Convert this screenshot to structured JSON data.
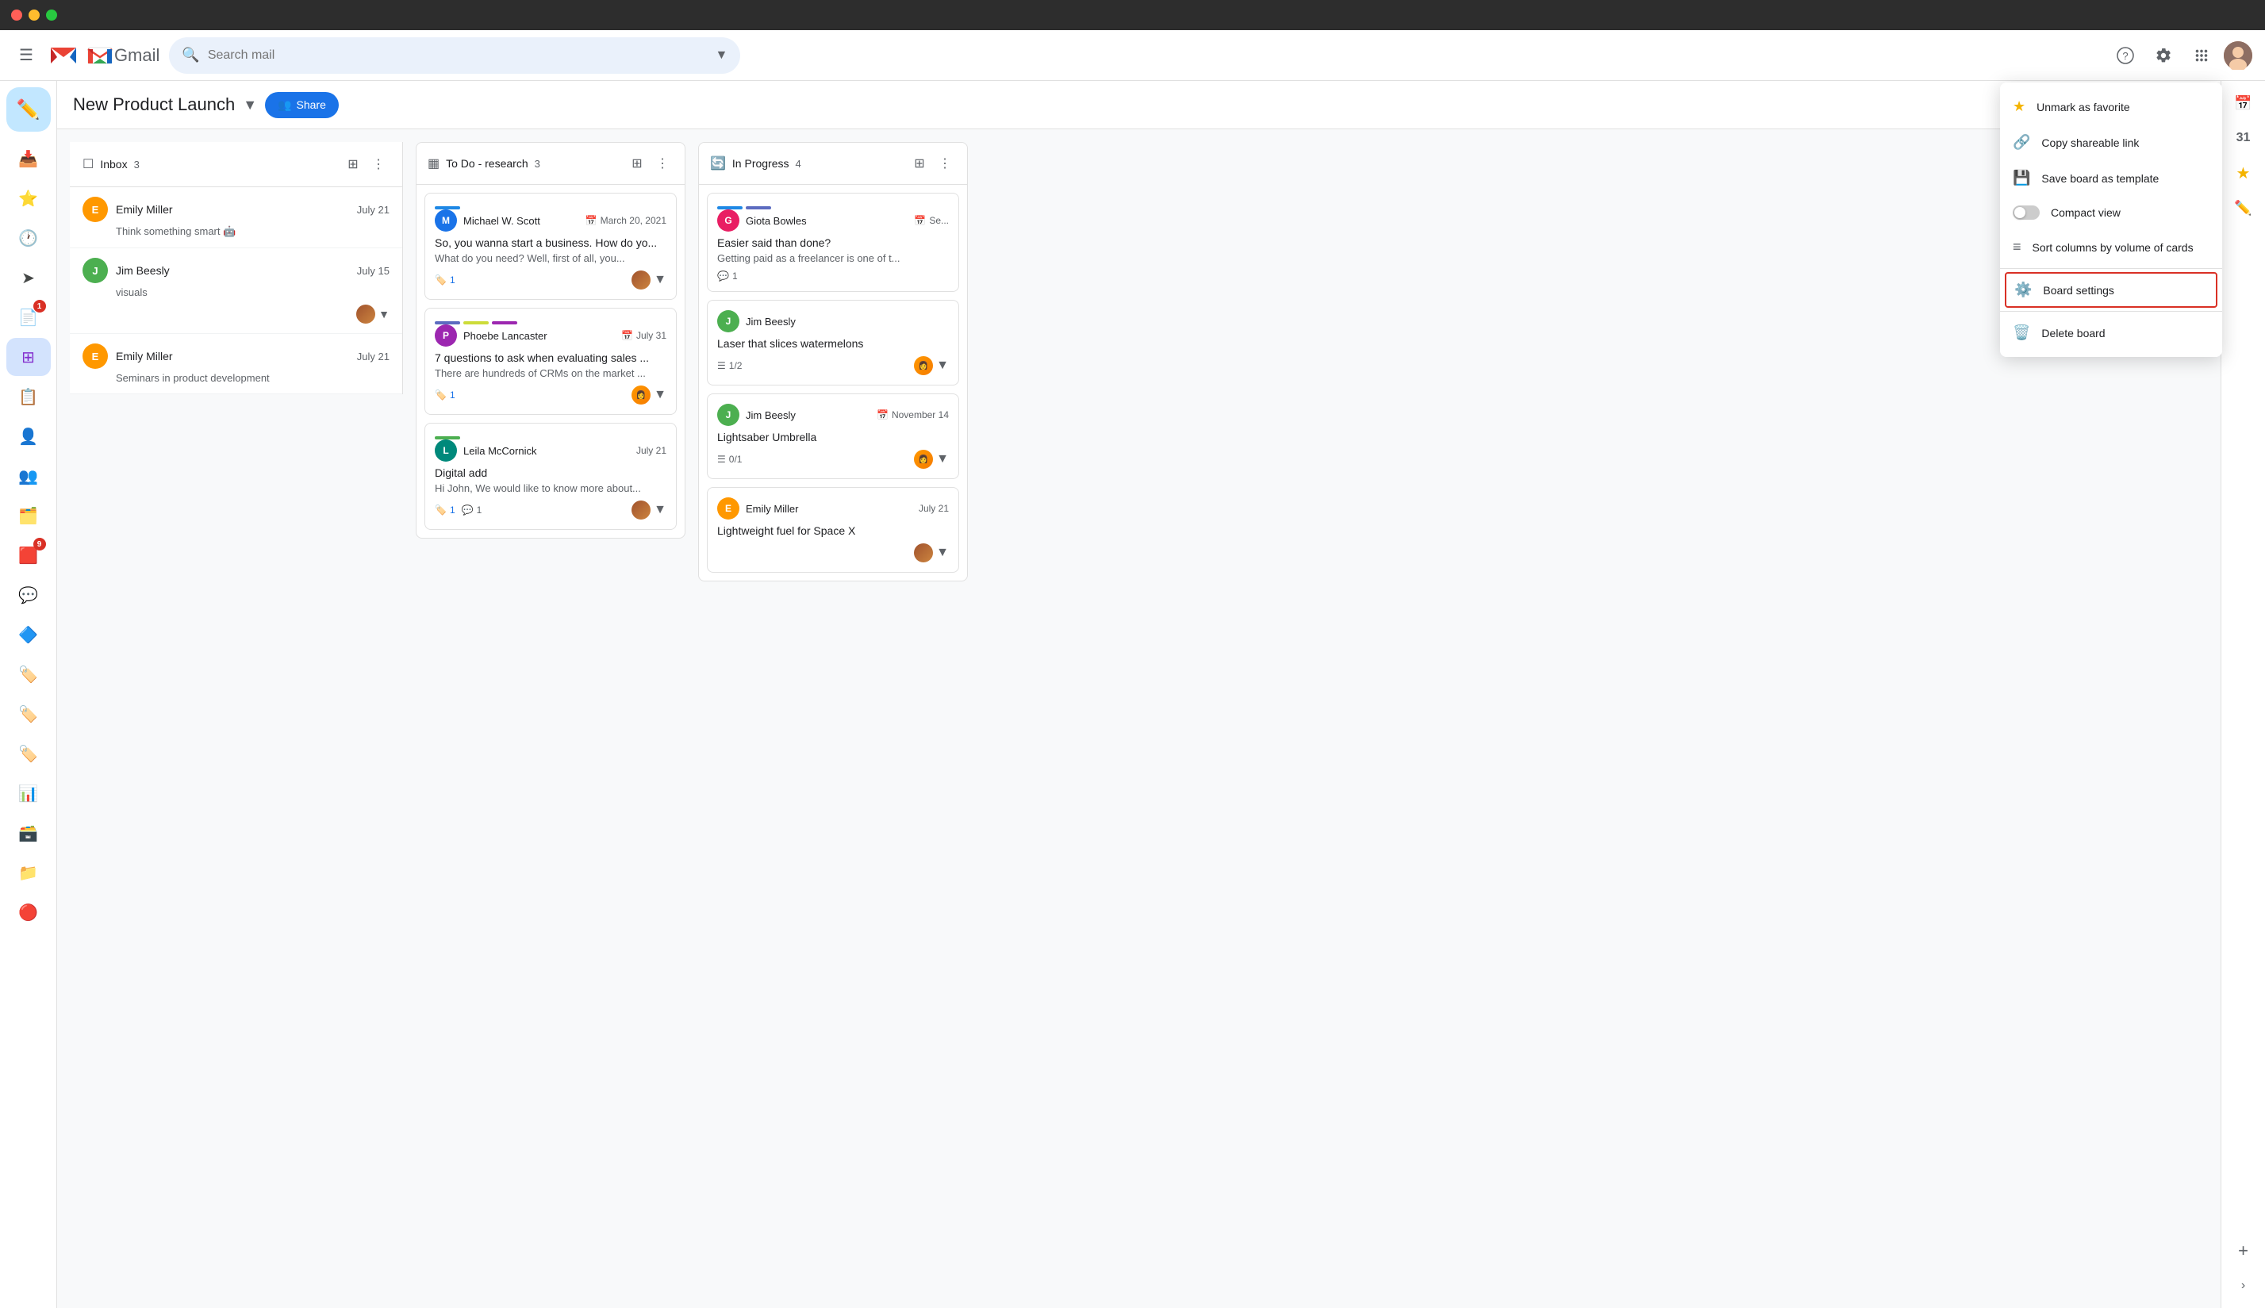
{
  "titlebar": {
    "close": "close",
    "minimize": "minimize",
    "maximize": "maximize"
  },
  "topbar": {
    "menu_label": "menu",
    "gmail_label": "Gmail",
    "search_placeholder": "Search mail",
    "help_label": "help",
    "settings_label": "settings",
    "apps_label": "apps",
    "avatar_label": "User avatar"
  },
  "board": {
    "title": "New Product Launch",
    "share_label": "Share",
    "three_dots_label": "More options"
  },
  "inbox_column": {
    "icon": "📥",
    "title": "Inbox",
    "count": "3",
    "items": [
      {
        "author": "Emily Miller",
        "date": "July 21",
        "preview": "Think something smart 🤖",
        "avatar_letter": "E",
        "avatar_color": "av-e"
      },
      {
        "author": "Jim Beesly",
        "date": "July 15",
        "preview": "visuals",
        "avatar_letter": "J",
        "avatar_color": "av-j"
      },
      {
        "author": "Emily Miller",
        "date": "July 21",
        "preview": "Seminars in product development",
        "avatar_letter": "E",
        "avatar_color": "av-e"
      }
    ]
  },
  "todo_column": {
    "title": "To Do - research",
    "count": "3",
    "cards": [
      {
        "author": "Michael W. Scott",
        "date": "March 20, 2021",
        "title": "So, you wanna start a business. How do yo...",
        "desc": "What do you need? Well, first of all, you...",
        "tags_count": "1",
        "avatar_letter": "M",
        "avatar_color": "av-m",
        "tag_colors": [
          "#1e88e5"
        ]
      },
      {
        "author": "Phoebe Lancaster",
        "date": "July 31",
        "title": "7 questions to ask when evaluating sales ...",
        "desc": "There are hundreds of CRMs on the market ...",
        "tags_count": "1",
        "avatar_letter": "P",
        "avatar_color": "av-p",
        "tag_colors": [
          "#5c6bc0",
          "#cddc39",
          "#9c27b0"
        ]
      },
      {
        "author": "Leila McCornick",
        "date": "July 21",
        "title": "Digital add",
        "desc": "Hi John, We would like to know more about...",
        "tags_count": "1",
        "comments_count": "1",
        "avatar_letter": "L",
        "avatar_color": "av-l",
        "tag_colors": [
          "#4caf50"
        ]
      }
    ]
  },
  "inprogress_column": {
    "title": "In Progress",
    "count": "4",
    "cards": [
      {
        "author": "Giota Bowles",
        "date": "Se...",
        "title": "Easier said than done?",
        "desc": "Getting paid as a freelancer is one of t...",
        "comments_count": "1",
        "avatar_letter": "G",
        "avatar_color": "av-g",
        "tag_colors": [
          "#1e88e5",
          "#5c6bc0"
        ]
      },
      {
        "author": "Jim Beesly",
        "date": "",
        "title": "Laser that slices watermelons",
        "desc": "",
        "checklist": "1/2",
        "avatar_letter": "J",
        "avatar_color": "av-j"
      },
      {
        "author": "Jim Beesly",
        "date": "November 14",
        "title": "Lightsaber Umbrella",
        "desc": "",
        "checklist": "0/1",
        "avatar_letter": "J",
        "avatar_color": "av-j"
      },
      {
        "author": "Emily Miller",
        "date": "July 21",
        "title": "Lightweight fuel for Space X",
        "desc": "",
        "avatar_letter": "E",
        "avatar_color": "av-e"
      }
    ]
  },
  "dropdown_menu": {
    "items": [
      {
        "id": "unmark-favorite",
        "icon": "star",
        "label": "Unmark as favorite"
      },
      {
        "id": "copy-link",
        "icon": "link",
        "label": "Copy shareable link"
      },
      {
        "id": "save-template",
        "icon": "save",
        "label": "Save board as template"
      },
      {
        "id": "compact-view",
        "icon": "toggle",
        "label": "Compact view"
      },
      {
        "id": "sort-columns",
        "icon": "sort",
        "label": "Sort columns by volume of cards"
      },
      {
        "id": "board-settings",
        "icon": "gear",
        "label": "Board settings",
        "highlighted": true
      },
      {
        "id": "delete-board",
        "icon": "trash",
        "label": "Delete board"
      }
    ]
  },
  "right_sidebar": {
    "items": [
      {
        "id": "calendar",
        "icon": "📅"
      },
      {
        "id": "tasks",
        "icon": "✓"
      },
      {
        "id": "plus",
        "icon": "+"
      },
      {
        "id": "edit",
        "icon": "✏️"
      }
    ]
  }
}
